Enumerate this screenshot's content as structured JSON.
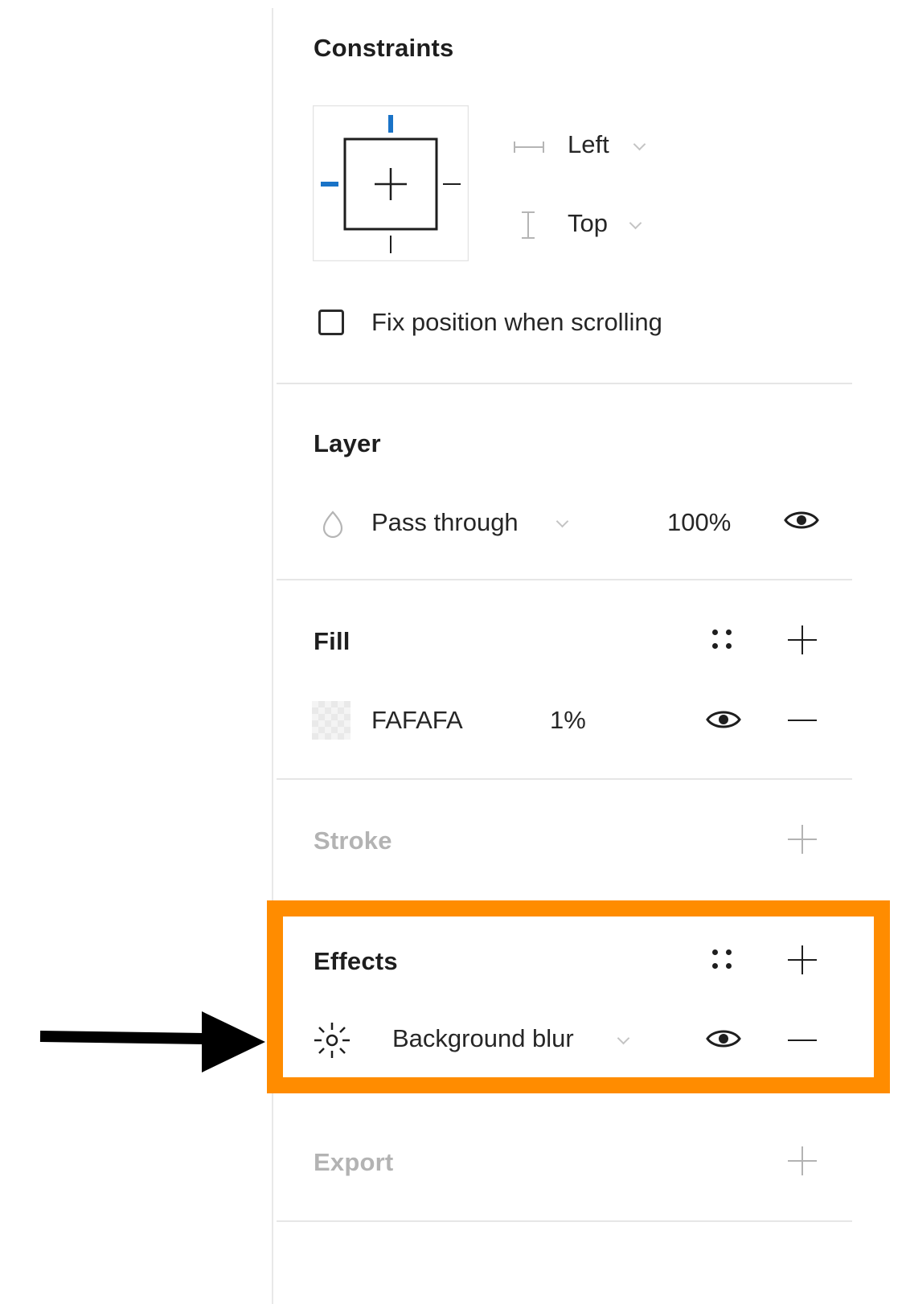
{
  "constraints": {
    "title": "Constraints",
    "horizontal": "Left",
    "vertical": "Top",
    "fix_position_label": "Fix position when scrolling",
    "fix_position_checked": false
  },
  "layer": {
    "title": "Layer",
    "blend_mode": "Pass through",
    "opacity": "100%"
  },
  "fill": {
    "title": "Fill",
    "hex": "FAFAFA",
    "opacity": "1%",
    "swatch_color": "#FAFAFA"
  },
  "stroke": {
    "title": "Stroke"
  },
  "effects": {
    "title": "Effects",
    "effect_type": "Background blur"
  },
  "export": {
    "title": "Export"
  },
  "colors": {
    "constraint_accent": "#1a73c7",
    "highlight": "#ff8c00",
    "arrow": "#000000"
  }
}
